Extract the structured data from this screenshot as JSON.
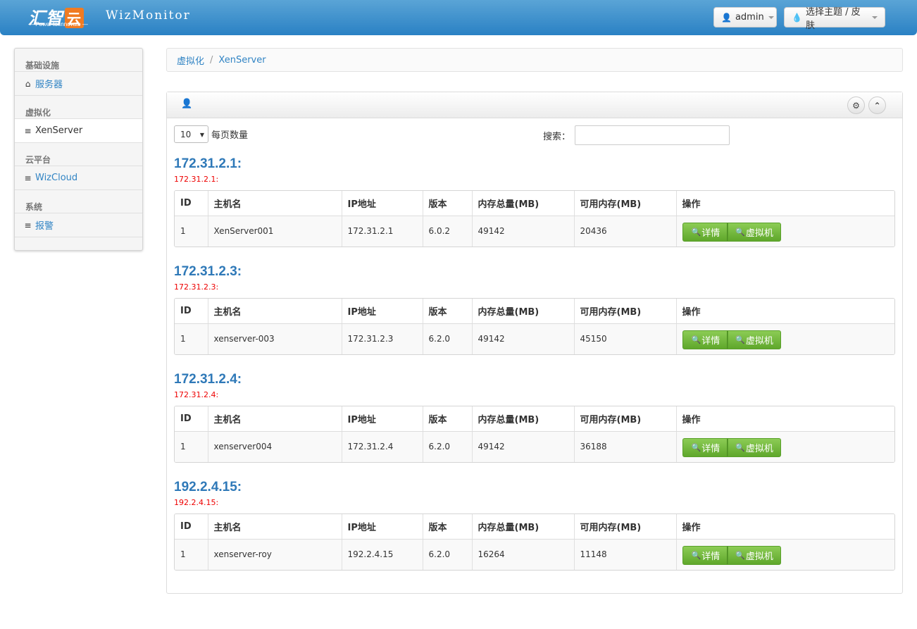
{
  "navbar": {
    "logo_text": "汇智",
    "logo_cloud": "云",
    "logo_slogan": "— Power to Innovate —",
    "brand": "WizMonitor",
    "user_label": "admin",
    "theme_label": "选择主题 / 皮肤"
  },
  "sidebar": {
    "sections": [
      {
        "header": "基础设施",
        "item": "服务器",
        "icon": "home-icon"
      },
      {
        "header": "虚拟化",
        "item": "XenServer",
        "icon": "list-icon"
      },
      {
        "header": "云平台",
        "item": "WizCloud",
        "icon": "list-icon"
      },
      {
        "header": "系统",
        "item": "报警",
        "icon": "list-icon"
      }
    ]
  },
  "breadcrumb": {
    "parent": "虚拟化",
    "separator": "/",
    "current": "XenServer"
  },
  "controls": {
    "page_length": "10",
    "page_length_label": "每页数量",
    "search_label": "搜索："
  },
  "columns": [
    "ID",
    "主机名",
    "IP地址",
    "版本",
    "内存总量(MB)",
    "可用内存(MB)",
    "操作"
  ],
  "actions": {
    "detail": "详情",
    "vm": "虚拟机"
  },
  "groups": [
    {
      "title": "172.31.2.1:",
      "subtitle": "172.31.2.1:",
      "row": {
        "id": "1",
        "hostname": "XenServer001",
        "ip": "172.31.2.1",
        "version": "6.0.2",
        "total_mem": "49142",
        "free_mem": "20436"
      }
    },
    {
      "title": "172.31.2.3:",
      "subtitle": "172.31.2.3:",
      "row": {
        "id": "1",
        "hostname": "xenserver-003",
        "ip": "172.31.2.3",
        "version": "6.2.0",
        "total_mem": "49142",
        "free_mem": "45150"
      }
    },
    {
      "title": "172.31.2.4:",
      "subtitle": "172.31.2.4:",
      "row": {
        "id": "1",
        "hostname": "xenserver004",
        "ip": "172.31.2.4",
        "version": "6.2.0",
        "total_mem": "49142",
        "free_mem": "36188"
      }
    },
    {
      "title": "192.2.4.15:",
      "subtitle": "192.2.4.15:",
      "row": {
        "id": "1",
        "hostname": "xenserver-roy",
        "ip": "192.2.4.15",
        "version": "6.2.0",
        "total_mem": "16264",
        "free_mem": "11148"
      }
    }
  ],
  "colors": {
    "navbar": "#2a81c4",
    "link": "#3184c4",
    "title": "#2f79b8",
    "subtitle": "#e00000",
    "button": "#6cb33f",
    "logo_accent": "#f07b22"
  }
}
